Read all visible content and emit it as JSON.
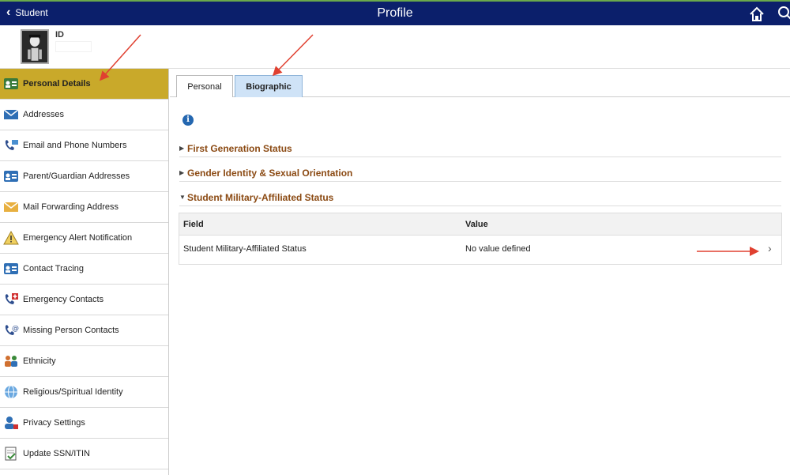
{
  "header": {
    "back_label": "Student",
    "title": "Profile"
  },
  "student": {
    "id_label": "ID"
  },
  "sidebar": {
    "items": [
      {
        "label": "Personal Details",
        "icon": "id-card-icon"
      },
      {
        "label": "Addresses",
        "icon": "envelope-icon"
      },
      {
        "label": "Email and Phone Numbers",
        "icon": "phone-email-icon"
      },
      {
        "label": "Parent/Guardian Addresses",
        "icon": "contact-card-icon"
      },
      {
        "label": "Mail Forwarding Address",
        "icon": "mail-icon"
      },
      {
        "label": "Emergency Alert Notification",
        "icon": "warning-icon"
      },
      {
        "label": "Contact Tracing",
        "icon": "contact-card-icon"
      },
      {
        "label": "Emergency Contacts",
        "icon": "phone-emergency-icon"
      },
      {
        "label": "Missing Person Contacts",
        "icon": "phone-at-icon"
      },
      {
        "label": "Ethnicity",
        "icon": "people-icon"
      },
      {
        "label": "Religious/Spiritual Identity",
        "icon": "globe-icon"
      },
      {
        "label": "Privacy Settings",
        "icon": "user-lock-icon"
      },
      {
        "label": "Update SSN/ITIN",
        "icon": "document-check-icon"
      }
    ]
  },
  "tabs": [
    {
      "label": "Personal"
    },
    {
      "label": "Biographic"
    }
  ],
  "sections": [
    {
      "label": "First Generation Status",
      "expanded": false
    },
    {
      "label": "Gender Identity & Sexual Orientation",
      "expanded": false
    },
    {
      "label": "Student Military-Affiliated Status",
      "expanded": true
    }
  ],
  "grid": {
    "col_field": "Field",
    "col_value": "Value",
    "rows": [
      {
        "field": "Student Military-Affiliated Status",
        "value": "No value defined"
      }
    ]
  },
  "colors": {
    "header_bg": "#0b1f6b",
    "active_sidebar": "#c9a92a",
    "section_text": "#8b4a13",
    "active_tab": "#cfe3f7",
    "annotation": "#e04030"
  }
}
